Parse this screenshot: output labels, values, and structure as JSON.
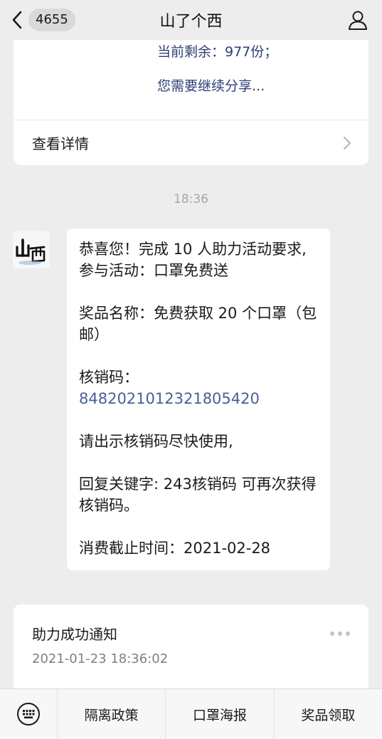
{
  "header": {
    "back_count": "4655",
    "title": "山了个西"
  },
  "top_card": {
    "remaining_line": "当前剩余：977份；",
    "share_line": "您需要继续分享...",
    "details_label": "查看详情"
  },
  "timestamp": "18:36",
  "message": {
    "line1": "恭喜您！完成 10 人助力活动要求,",
    "line2": "参与活动：口罩免费送",
    "line3": "奖品名称：免费获取 20 个口罩（包邮）",
    "line4_label": "核销码：",
    "line4_code": "8482021012321805420",
    "line5": "请出示核销码尽快使用,",
    "line6": "回复关键字: 243核销码  可再次获得核销码。",
    "line7": "消费截止时间：2021-02-28"
  },
  "notification": {
    "title": "助力成功通知",
    "time": "2021-01-23 18:36:02"
  },
  "menu": {
    "items": [
      "隔离政策",
      "口罩海报",
      "奖品领取"
    ]
  },
  "colors": {
    "link_blue": "#2c3f76",
    "code_blue": "#4a5f94",
    "background": "#ededed"
  }
}
